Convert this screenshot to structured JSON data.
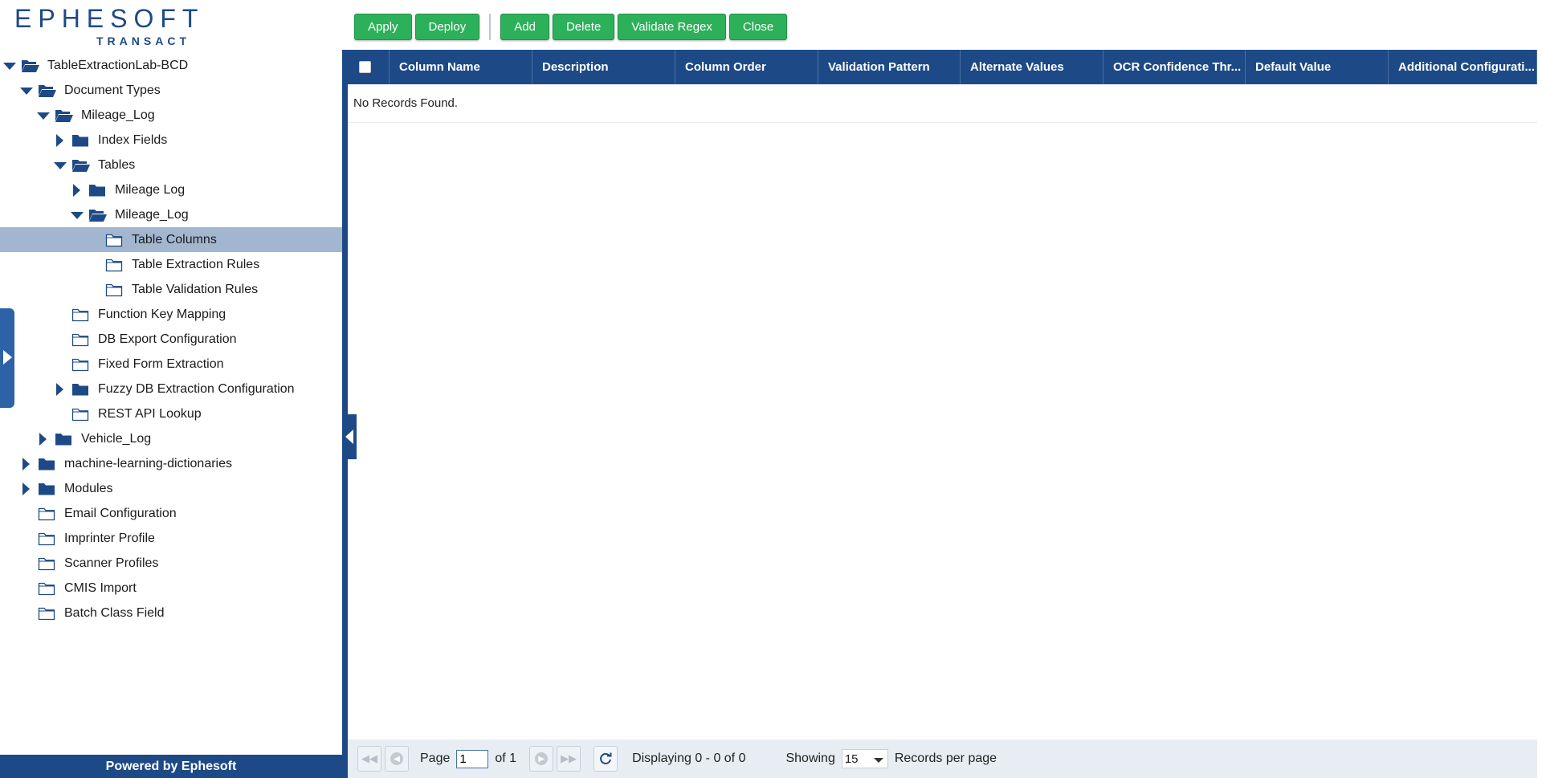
{
  "logo": {
    "word": "EPHESOFT",
    "sub": "TRANSACT"
  },
  "toolbar": {
    "apply": "Apply",
    "deploy": "Deploy",
    "add": "Add",
    "delete": "Delete",
    "validate_regex": "Validate Regex",
    "close": "Close"
  },
  "tree": [
    {
      "label": "TableExtractionLab-BCD",
      "level": 0,
      "arrow": "expanded",
      "folder": "open",
      "selected": false
    },
    {
      "label": "Document Types",
      "level": 1,
      "arrow": "expanded",
      "folder": "open",
      "selected": false
    },
    {
      "label": "Mileage_Log",
      "level": 2,
      "arrow": "expanded",
      "folder": "open",
      "selected": false
    },
    {
      "label": "Index Fields",
      "level": 3,
      "arrow": "collapsed",
      "folder": "closed",
      "selected": false
    },
    {
      "label": "Tables",
      "level": 3,
      "arrow": "expanded",
      "folder": "open",
      "selected": false
    },
    {
      "label": "Mileage Log",
      "level": 4,
      "arrow": "collapsed",
      "folder": "closed",
      "selected": false
    },
    {
      "label": "Mileage_Log",
      "level": 4,
      "arrow": "expanded",
      "folder": "open",
      "selected": false
    },
    {
      "label": "Table Columns",
      "level": 5,
      "arrow": "none",
      "folder": "leaf",
      "selected": true
    },
    {
      "label": "Table Extraction Rules",
      "level": 5,
      "arrow": "none",
      "folder": "leaf",
      "selected": false
    },
    {
      "label": "Table Validation Rules",
      "level": 5,
      "arrow": "none",
      "folder": "leaf",
      "selected": false
    },
    {
      "label": "Function Key Mapping",
      "level": 3,
      "arrow": "none",
      "folder": "leaf",
      "selected": false
    },
    {
      "label": "DB Export Configuration",
      "level": 3,
      "arrow": "none",
      "folder": "leaf",
      "selected": false
    },
    {
      "label": "Fixed Form Extraction",
      "level": 3,
      "arrow": "none",
      "folder": "leaf",
      "selected": false
    },
    {
      "label": "Fuzzy DB Extraction Configuration",
      "level": 3,
      "arrow": "collapsed",
      "folder": "closed",
      "selected": false
    },
    {
      "label": "REST API Lookup",
      "level": 3,
      "arrow": "none",
      "folder": "leaf",
      "selected": false
    },
    {
      "label": "Vehicle_Log",
      "level": 2,
      "arrow": "collapsed",
      "folder": "closed",
      "selected": false
    },
    {
      "label": "machine-learning-dictionaries",
      "level": 1,
      "arrow": "collapsed",
      "folder": "closed",
      "selected": false
    },
    {
      "label": "Modules",
      "level": 1,
      "arrow": "collapsed",
      "folder": "closed",
      "selected": false
    },
    {
      "label": "Email Configuration",
      "level": 1,
      "arrow": "none",
      "folder": "leaf",
      "selected": false
    },
    {
      "label": "Imprinter Profile",
      "level": 1,
      "arrow": "none",
      "folder": "leaf",
      "selected": false
    },
    {
      "label": "Scanner Profiles",
      "level": 1,
      "arrow": "none",
      "folder": "leaf",
      "selected": false
    },
    {
      "label": "CMIS Import",
      "level": 1,
      "arrow": "none",
      "folder": "leaf",
      "selected": false
    },
    {
      "label": "Batch Class Field",
      "level": 1,
      "arrow": "none",
      "folder": "leaf",
      "selected": false
    }
  ],
  "footer": "Powered by Ephesoft",
  "grid": {
    "columns": [
      "Column Name",
      "Description",
      "Column Order",
      "Validation Pattern",
      "Alternate Values",
      "OCR Confidence Thr...",
      "Default Value",
      "Additional Configurati..."
    ],
    "empty_text": "No Records Found."
  },
  "pager": {
    "page_label": "Page",
    "page_value": "1",
    "of_label": "of 1",
    "displaying": "Displaying 0 - 0 of 0",
    "showing": "Showing",
    "per_page_value": "15",
    "records_per_page": "Records per page"
  },
  "colors": {
    "brand_blue": "#1d4a86",
    "button_green": "#2cb05a",
    "selected_row": "#a3b6d0"
  }
}
